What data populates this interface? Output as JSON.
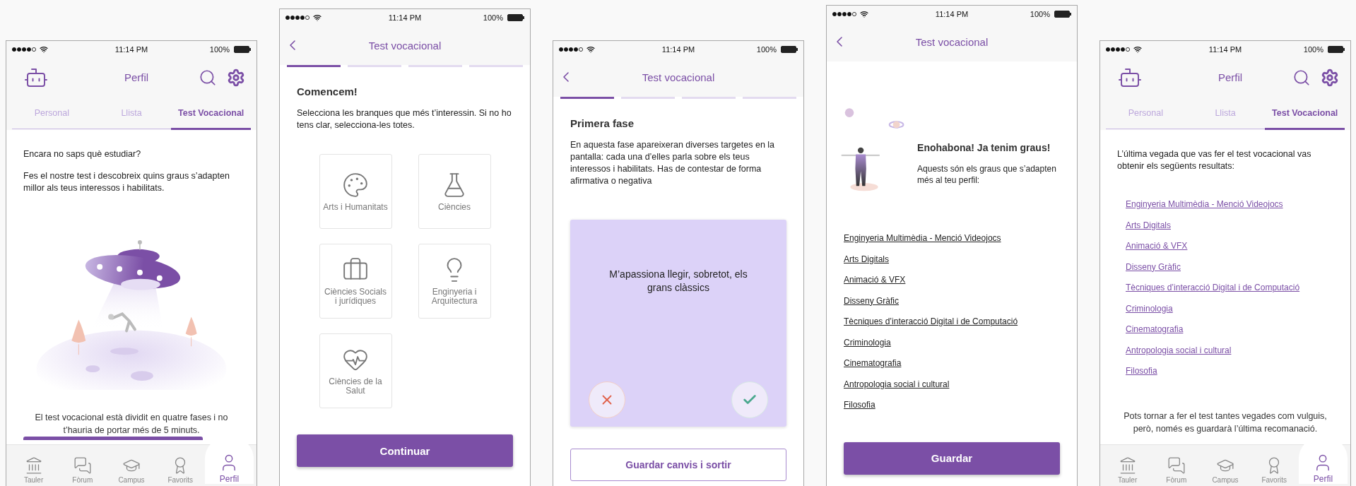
{
  "screens": [
    {
      "kind": "profile",
      "status_bar": {
        "time": "11:14 PM",
        "battery": "100%"
      },
      "header": {
        "title": "Perfil"
      },
      "tabs": [
        {
          "label": "Personal",
          "selected": false
        },
        {
          "label": "Llista",
          "selected": false
        },
        {
          "label": "Test Vocacional",
          "selected": true
        }
      ],
      "body": [
        {
          "kind": "paragraph",
          "text": "Encara no saps què estudiar?"
        },
        {
          "kind": "paragraph",
          "text": "Fes el nostre test i descobreix quins graus s’adapten millor als teus interessos i habilitats."
        },
        {
          "kind": "ufo_illustration"
        },
        {
          "kind": "note",
          "text": "El test vocacional està dividit en quatre fases i no t’hauria de portar més de 5 minuts."
        },
        {
          "kind": "button_edge"
        }
      ],
      "bottom_nav": [
        {
          "label": "Tauler",
          "selected": false
        },
        {
          "label": "Fòrum",
          "selected": false
        },
        {
          "label": "Campus",
          "selected": false
        },
        {
          "label": "Favorits",
          "selected": false
        },
        {
          "label": "Perfil",
          "selected": true
        }
      ]
    },
    {
      "kind": "test",
      "status_bar": {
        "time": "11:14 PM",
        "battery": "100%"
      },
      "header": {
        "title": "Test vocacional"
      },
      "steps": [
        {
          "selected": true
        },
        {
          "selected": false
        },
        {
          "selected": false
        },
        {
          "selected": false
        }
      ],
      "body": [
        {
          "kind": "heading",
          "text": "Comencem!"
        },
        {
          "kind": "paragraph",
          "text": "Selecciona les branques que més t’interessin. Si no ho tens clar, selecciona-les totes."
        },
        {
          "kind": "categories",
          "items": [
            "Arts i Humanitats",
            "Ciències",
            "Ciències Socials i jurídiques",
            "Enginyeria i Arquitectura",
            "Ciències de la Salut"
          ]
        },
        {
          "kind": "primary_button",
          "label": "Continuar"
        }
      ]
    },
    {
      "kind": "test",
      "status_bar": {
        "time": "11:14 PM",
        "battery": "100%"
      },
      "header": {
        "title": "Test vocacional"
      },
      "steps": [
        {
          "selected": true
        },
        {
          "selected": false
        },
        {
          "selected": false
        },
        {
          "selected": false
        }
      ],
      "body": [
        {
          "kind": "heading",
          "text": "Primera fase"
        },
        {
          "kind": "paragraph",
          "text": "En aquesta fase apareixeran diverses targetes en la pantalla: cada una d’elles parla sobre els teus interessos i habilitats. Has de contestar de forma afirmativa o negativa"
        },
        {
          "kind": "question_card",
          "text": "M’apassiona llegir, sobretot, els grans clàssics"
        },
        {
          "kind": "outline_button",
          "label": "Guardar canvis i sortir"
        }
      ]
    },
    {
      "kind": "test",
      "status_bar": {
        "time": "11:14 PM",
        "battery": "100%"
      },
      "header": {
        "title": "Test vocacional"
      },
      "body": [
        {
          "kind": "hero",
          "title": "Enohabona! Ja tenim graus!",
          "text": "Aquests són els graus que s’adapten més al teu perfil:"
        },
        {
          "kind": "links",
          "items": [
            "Enginyeria Multimèdia - Menció Videojocs",
            "Arts Digitals",
            "Animació & VFX",
            "Disseny Gràfic",
            "Tècniques d’interacció Digital i de Computació",
            "Criminologia",
            "Cinematografia",
            "Antropologia social i cultural",
            "Filosofia"
          ]
        },
        {
          "kind": "primary_button",
          "label": "Guardar"
        }
      ]
    },
    {
      "kind": "profile",
      "status_bar": {
        "time": "11:14 PM",
        "battery": "100%"
      },
      "header": {
        "title": "Perfil"
      },
      "tabs": [
        {
          "label": "Personal",
          "selected": false
        },
        {
          "label": "Llista",
          "selected": false
        },
        {
          "label": "Test Vocacional",
          "selected": true
        }
      ],
      "body": [
        {
          "kind": "paragraph",
          "text": "L’última vegada que vas fer el test vocacional vas obtenir els següents resultats:"
        },
        {
          "kind": "links",
          "items": [
            "Enginyeria Multimèdia - Menció Videojocs",
            "Arts Digitals",
            "Animació & VFX",
            "Disseny Gràfic",
            "Tècniques d’interacció Digital i de Computació",
            "Criminologia",
            "Cinematografia",
            "Antropologia social i cultural",
            "Filosofia"
          ]
        },
        {
          "kind": "note",
          "text": "Pots tornar a fer el test tantes vegades com vulguis, però, només es guardarà l’última recomanació."
        }
      ],
      "bottom_nav": [
        {
          "label": "Tauler",
          "selected": false
        },
        {
          "label": "Fòrum",
          "selected": false
        },
        {
          "label": "Campus",
          "selected": false
        },
        {
          "label": "Favorits",
          "selected": false
        },
        {
          "label": "Perfil",
          "selected": true
        }
      ]
    }
  ]
}
